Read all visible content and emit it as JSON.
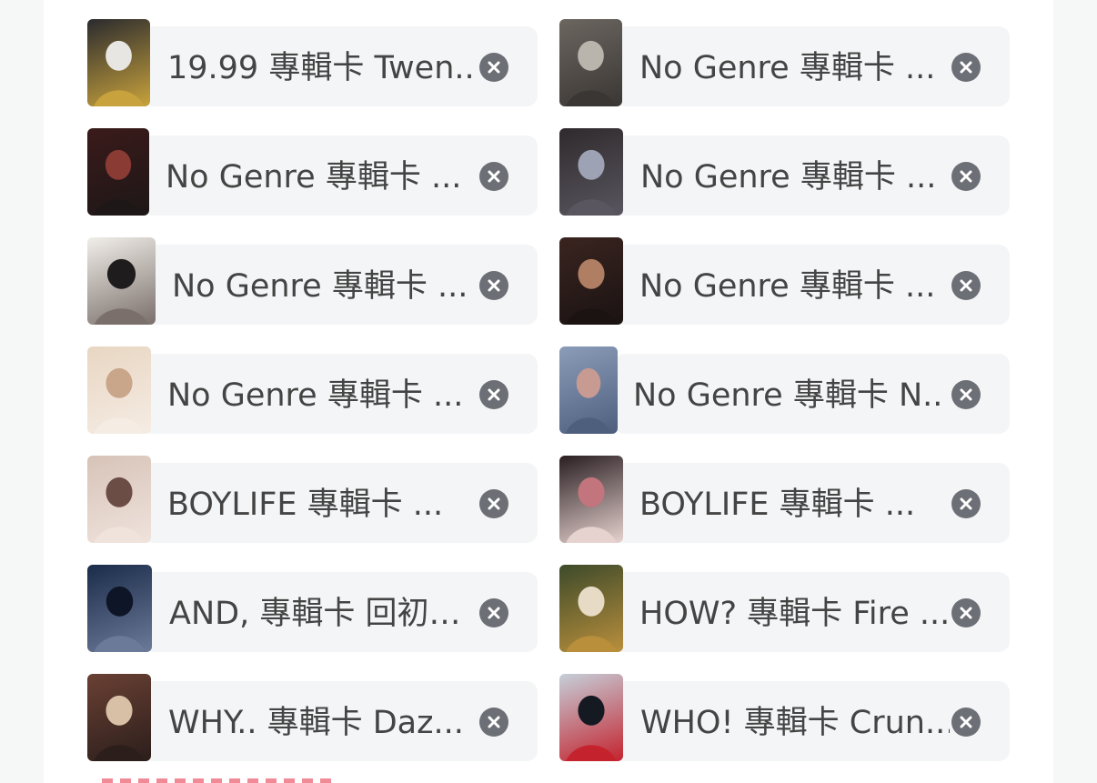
{
  "album_cards": [
    {
      "label": "19.99 專輯卡 Twen...",
      "thumb_colors": [
        "#2b2b2e",
        "#e8e6e3",
        "#c8a23c"
      ]
    },
    {
      "label": "No Genre 專輯卡 ...",
      "thumb_colors": [
        "#6b6660",
        "#b9b5ad",
        "#3a3633"
      ]
    },
    {
      "label": "No Genre 專輯卡 ...",
      "thumb_colors": [
        "#3b1a1a",
        "#8a3b34",
        "#1d1717"
      ]
    },
    {
      "label": "No Genre 專輯卡 ...",
      "thumb_colors": [
        "#2e2a2c",
        "#9da3b4",
        "#5a5660"
      ]
    },
    {
      "label": "No Genre 專輯卡 ...",
      "thumb_colors": [
        "#f1eee9",
        "#1f1c1d",
        "#7a6f6a"
      ]
    },
    {
      "label": "No Genre 專輯卡 ...",
      "thumb_colors": [
        "#3a2420",
        "#b07e62",
        "#1a1312"
      ]
    },
    {
      "label": "No Genre 專輯卡 ...",
      "thumb_colors": [
        "#e8d6c2",
        "#c9a58a",
        "#f5ece4"
      ]
    },
    {
      "label": "No Genre 專輯卡 N...",
      "thumb_colors": [
        "#8b9cb8",
        "#c79a92",
        "#4e5f7e"
      ]
    },
    {
      "label": "BOYLIFE 專輯卡 ...",
      "thumb_colors": [
        "#d7c3b8",
        "#6b4d45",
        "#efe3dc"
      ]
    },
    {
      "label": "BOYLIFE 專輯卡 ...",
      "thumb_colors": [
        "#2a1e22",
        "#c2757c",
        "#e6d3cf"
      ]
    },
    {
      "label": "AND, 專輯卡 回初…",
      "thumb_colors": [
        "#1b2b4a",
        "#0e1526",
        "#6b7a98"
      ]
    },
    {
      "label": "HOW? 專輯卡 Fire ...",
      "thumb_colors": [
        "#3d4a2a",
        "#e7dbc5",
        "#b98f3c"
      ]
    },
    {
      "label": "WHY.. 專輯卡 Daz...",
      "thumb_colors": [
        "#6a4034",
        "#d8c0a6",
        "#2b1e1b"
      ]
    },
    {
      "label": "WHO! 專輯卡 Crun...",
      "thumb_colors": [
        "#c5cfd9",
        "#151a22",
        "#c4232e"
      ]
    }
  ],
  "colors": {
    "chip_bg": "#f4f5f6",
    "remove_icon_bg": "#6c6f75",
    "label_text": "#444444",
    "hint_dashes": "#f08a96"
  }
}
